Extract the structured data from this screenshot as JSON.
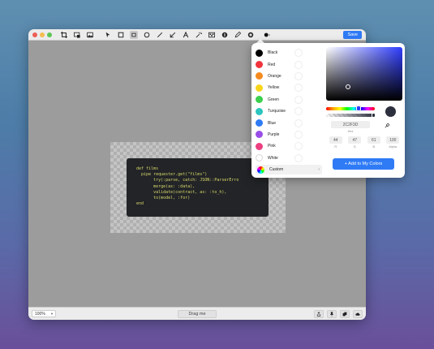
{
  "toolbar": {
    "save_label": "Save"
  },
  "code": {
    "lines": [
      "def films",
      "  pipe requester.get(\"films\")",
      "       try(:parse, catch: JSON::ParserErro",
      "       merge(as: :data),",
      "       validate(contract, as: :to_h),",
      "       to(model, :for)",
      "end"
    ]
  },
  "bottombar": {
    "zoom_label": "100%",
    "drag_label": "Drag me"
  },
  "colors": {
    "items": [
      {
        "label": "Black",
        "hex": "#000000"
      },
      {
        "label": "Red",
        "hex": "#f0343c"
      },
      {
        "label": "Orange",
        "hex": "#f58a1f"
      },
      {
        "label": "Yellow",
        "hex": "#f7d51a"
      },
      {
        "label": "Green",
        "hex": "#3ccf4e"
      },
      {
        "label": "Turquoise",
        "hex": "#2cc5c0"
      },
      {
        "label": "Blue",
        "hex": "#2e7bf6"
      },
      {
        "label": "Purple",
        "hex": "#9a4ee8"
      },
      {
        "label": "Pink",
        "hex": "#ec3f80"
      },
      {
        "label": "White",
        "hex": "#ffffff"
      }
    ],
    "custom_label": "Custom"
  },
  "picker": {
    "hex_value": "2C2F3D",
    "hex_label": "Hex",
    "r": "44",
    "g": "47",
    "b": "61",
    "a": "100",
    "r_label": "R",
    "g_label": "G",
    "b_label": "B",
    "a_label": "Alpha",
    "add_label": "+ Add to My Colors",
    "current_color": "#2c2f3d"
  }
}
